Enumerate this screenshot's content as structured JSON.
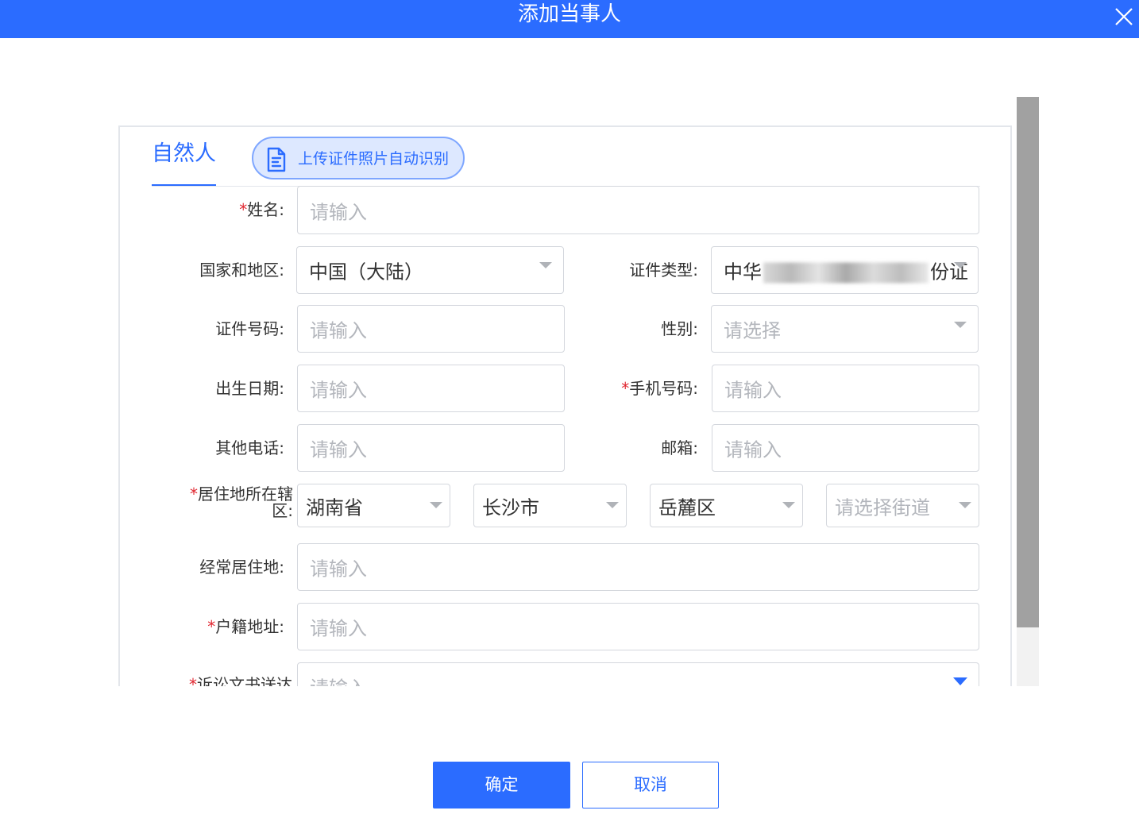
{
  "dialog": {
    "title": "添加当事人"
  },
  "tabs": {
    "natural_person": "自然人"
  },
  "upload": {
    "label": "上传证件照片自动识别"
  },
  "form": {
    "name": {
      "required_mark": "*",
      "label": "姓名:",
      "placeholder": "请输入"
    },
    "country": {
      "label": "国家和地区:",
      "value": "中国（大陆）"
    },
    "id_type": {
      "label": "证件类型:",
      "value_prefix": "中华",
      "value_suffix": "份证"
    },
    "id_number": {
      "label": "证件号码:",
      "placeholder": "请输入"
    },
    "gender": {
      "label": "性别:",
      "placeholder": "请选择"
    },
    "birth_date": {
      "label": "出生日期:",
      "placeholder": "请输入"
    },
    "mobile": {
      "required_mark": "*",
      "label": "手机号码:",
      "placeholder": "请输入"
    },
    "other_phone": {
      "label": "其他电话:",
      "placeholder": "请输入"
    },
    "email": {
      "label": "邮箱:",
      "placeholder": "请输入"
    },
    "residence": {
      "required_mark": "*",
      "label": "居住地所在辖区:",
      "province": "湖南省",
      "city": "长沙市",
      "district": "岳麓区",
      "street_placeholder": "请选择街道"
    },
    "usual_residence": {
      "label": "经常居住地:",
      "placeholder": "请输入"
    },
    "household_address": {
      "required_mark": "*",
      "label": "户籍地址:",
      "placeholder": "请输入"
    },
    "litigation_delivery": {
      "required_mark": "*",
      "label": "诉讼文书送达",
      "placeholder": "请输入"
    }
  },
  "footer": {
    "confirm_label": "确定",
    "cancel_label": "取消"
  },
  "colors": {
    "primary": "#2b6cff",
    "required": "#e0262f",
    "placeholder": "#b3b6bc",
    "border": "#d4d7dd"
  },
  "icons": {
    "close": "close-icon",
    "upload_doc": "document-scan-icon",
    "dropdown": "chevron-down-icon"
  }
}
